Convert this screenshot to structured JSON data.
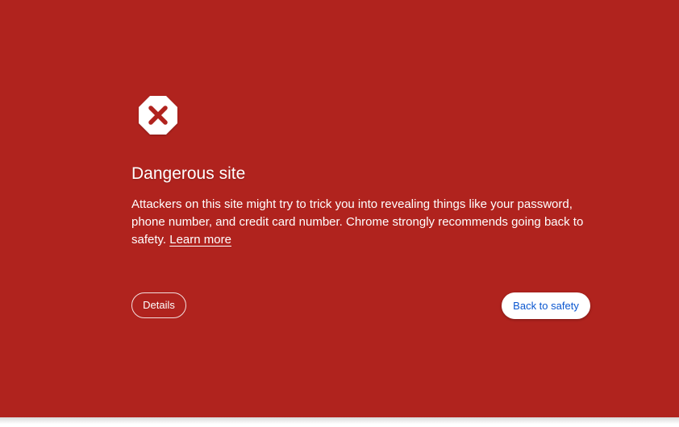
{
  "warning": {
    "icon": "danger-stop-icon",
    "title": "Dangerous site",
    "description_main": "Attackers on this site might try to trick you into revealing things like your password, phone number, and credit card number. Chrome strongly recommends going back to safety.",
    "learn_more": "Learn more"
  },
  "buttons": {
    "details": "Details",
    "back_to_safety": "Back to safety"
  },
  "colors": {
    "background": "#b0231e",
    "icon_x": "#b0231e",
    "primary_button_text": "#0b57d0"
  }
}
